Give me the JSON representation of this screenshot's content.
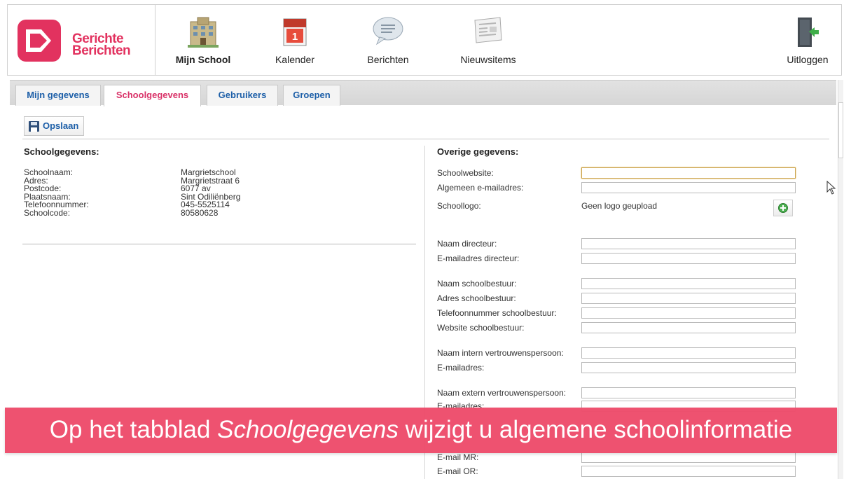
{
  "brand": {
    "line1": "Gerichte",
    "line2": "Berichten",
    "color": "#e2325f"
  },
  "nav": {
    "items": [
      {
        "label": "Mijn School",
        "icon": "school-building-icon"
      },
      {
        "label": "Kalender",
        "icon": "calendar-icon"
      },
      {
        "label": "Berichten",
        "icon": "speech-bubble-icon"
      },
      {
        "label": "Nieuwsitems",
        "icon": "newspaper-icon"
      }
    ],
    "logout": {
      "label": "Uitloggen",
      "icon": "exit-door-icon"
    }
  },
  "tabs": [
    {
      "label": "Mijn gegevens",
      "active": false
    },
    {
      "label": "Schoolgegevens",
      "active": true
    },
    {
      "label": "Gebruikers",
      "active": false
    },
    {
      "label": "Groepen",
      "active": false
    }
  ],
  "toolbar": {
    "save_label": "Opslaan",
    "save_icon": "floppy-disk-icon"
  },
  "school_info": {
    "title": "Schoolgegevens:",
    "rows": [
      {
        "label": "Schoolnaam:",
        "value": "Margrietschool"
      },
      {
        "label": "Adres:",
        "value": "Margrietstraat 6"
      },
      {
        "label": "Postcode:",
        "value": "6077 av"
      },
      {
        "label": "Plaatsnaam:",
        "value": "Sint Odiliënberg"
      },
      {
        "label": "Telefoonnummer:",
        "value": "045-5525114"
      },
      {
        "label": "Schoolcode:",
        "value": "80580628"
      }
    ]
  },
  "other_info": {
    "title": "Overige gegevens:",
    "fields": {
      "schoolwebsite": {
        "label": "Schoolwebsite:",
        "value": ""
      },
      "email": {
        "label": "Algemeen e-mailadres:",
        "value": ""
      },
      "logo": {
        "label": "Schoollogo:",
        "value": "Geen logo geupload",
        "add_icon": "add-circle-icon"
      },
      "director_name": {
        "label": "Naam directeur:",
        "value": ""
      },
      "director_email": {
        "label": "E-mailadres directeur:",
        "value": ""
      },
      "board_name": {
        "label": "Naam schoolbestuur:",
        "value": ""
      },
      "board_address": {
        "label": "Adres schoolbestuur:",
        "value": ""
      },
      "board_phone": {
        "label": "Telefoonnummer schoolbestuur:",
        "value": ""
      },
      "board_website": {
        "label": "Website schoolbestuur:",
        "value": ""
      },
      "internal_conf_name": {
        "label": "Naam intern vertrouwenspersoon:",
        "value": ""
      },
      "internal_conf_email": {
        "label": "E-mailadres:",
        "value": ""
      },
      "external_conf_name": {
        "label": "Naam extern vertrouwenspersoon:",
        "value": ""
      },
      "external_conf_email": {
        "label": "E-mailadres:",
        "value": ""
      },
      "email_mr": {
        "label": "E-mail MR:",
        "value": ""
      },
      "email_or": {
        "label": "E-mail OR:",
        "value": ""
      }
    }
  },
  "caption": {
    "before": "Op het tabblad ",
    "emphasis": "Schoolgegevens",
    "after": " wijzigt u algemene schoolinformatie",
    "background": "#ee4d6c"
  }
}
